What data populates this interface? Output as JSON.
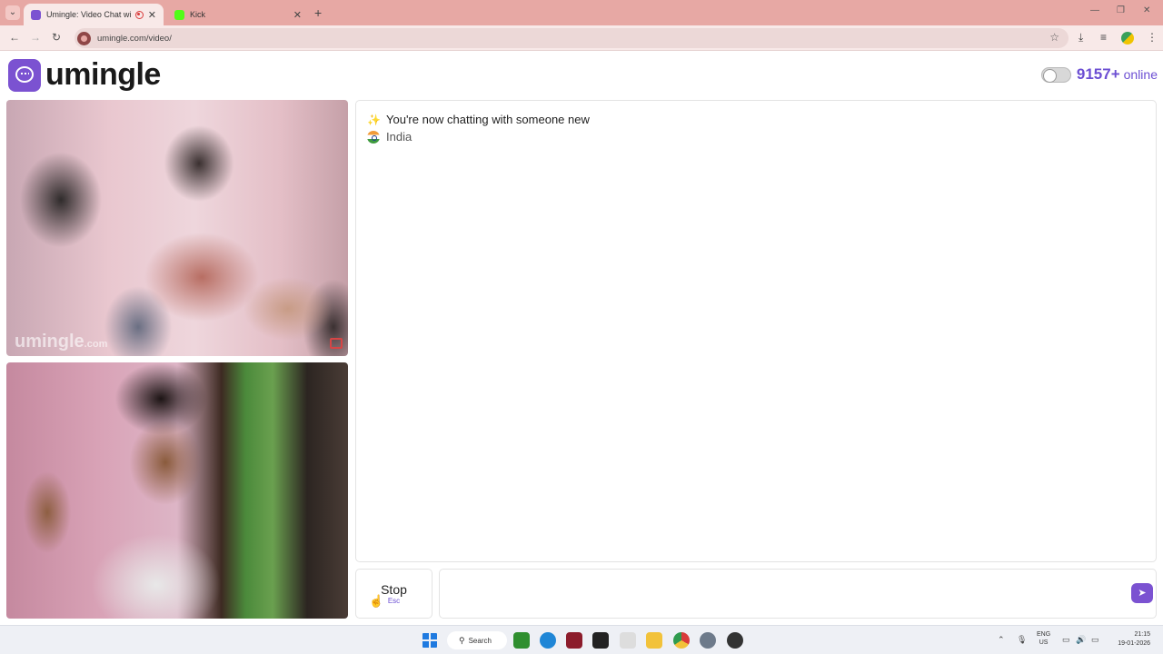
{
  "browser": {
    "tabs": [
      {
        "title": "Umingle: Video Chat with S",
        "active": true
      },
      {
        "title": "Kick",
        "active": false
      }
    ],
    "url": "umingle.com/video/"
  },
  "site": {
    "logo_text": "umingle",
    "online_count": "9157+",
    "online_label": "online",
    "watermark": "umingle",
    "watermark_suffix": ".com"
  },
  "chat": {
    "status_message": "You're now chatting with someone new",
    "country": "India"
  },
  "controls": {
    "stop_label": "Stop",
    "stop_shortcut": "Esc",
    "message_placeholder": ""
  },
  "taskbar": {
    "search_label": "Search",
    "lang_primary": "ENG",
    "lang_secondary": "US",
    "time": "21:15",
    "date": "19-01-2026"
  },
  "colors": {
    "accent": "#6c4fd3",
    "brand": "#7b52d1",
    "tab_bar": "#e7a8a4"
  }
}
